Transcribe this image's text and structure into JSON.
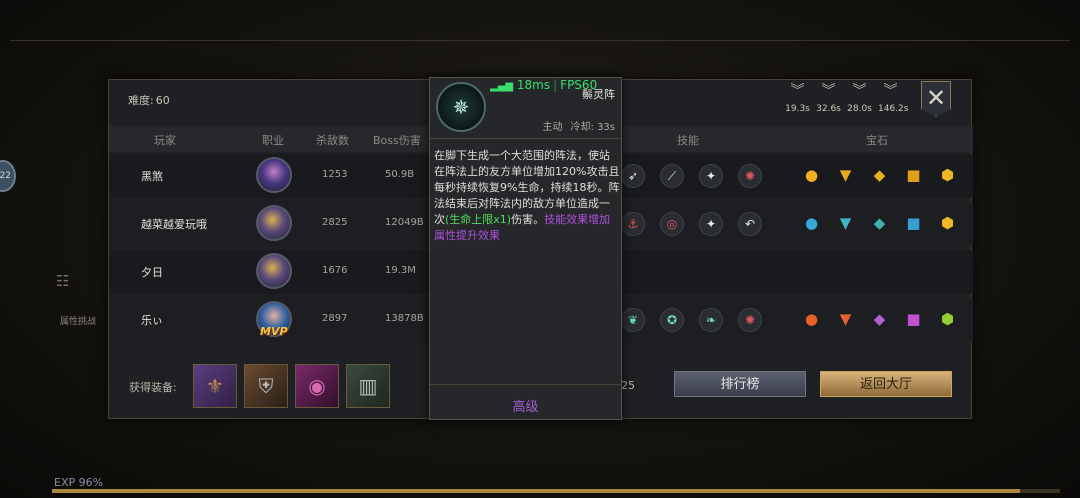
{
  "difficulty": {
    "label": "难度:",
    "value": "60"
  },
  "buffs": [
    {
      "icon": "chevron-rank-icon",
      "time": "19.3s"
    },
    {
      "icon": "chevron-rank-icon",
      "time": "32.6s"
    },
    {
      "icon": "chevron-rank-icon",
      "time": "28.0s"
    },
    {
      "icon": "chevron-rank-icon",
      "time": "146.2s"
    }
  ],
  "table": {
    "headers": {
      "player": "玩家",
      "class": "职业",
      "kills": "杀敌数",
      "boss_damage": "Boss伤害",
      "skills": "技能",
      "gems": "宝石"
    },
    "rows": [
      {
        "name": "黑煞",
        "kills": "1253",
        "boss": "50.9B"
      },
      {
        "name": "越菜越爱玩哦",
        "kills": "2825",
        "boss": "12049B"
      },
      {
        "name": "夕日",
        "kills": "1676",
        "boss": "19.3M"
      },
      {
        "name": "乐ぃ",
        "kills": "2897",
        "boss": "13878B",
        "mvp": "MVP"
      }
    ]
  },
  "loot": {
    "label": "获得装备:",
    "partial_number": "25"
  },
  "buttons": {
    "rank": "排行榜",
    "lobby": "返回大厅"
  },
  "tooltip": {
    "network": {
      "ping": "18ms",
      "fps": "FPS60"
    },
    "skill_name": "鬃灵阵",
    "type": "主动",
    "cooldown": "冷却: 33s",
    "desc_plain": "在脚下生成一个大范围的阵法，使站在阵法上的友方单位增加120%攻击且每秒持续恢复9%生命，持续18秒。阵法结束后对阵法内的敌方单位造成一次",
    "desc_green": "(生命上限x1)",
    "desc_after": "伤害。",
    "desc_purple": "技能效果增加属性提升效果",
    "advanced": "高级"
  },
  "background": {
    "attr_challenge": "属性挑战",
    "exp": "EXP 96%",
    "exp_fraction": 0.96,
    "side_badge": "22"
  }
}
